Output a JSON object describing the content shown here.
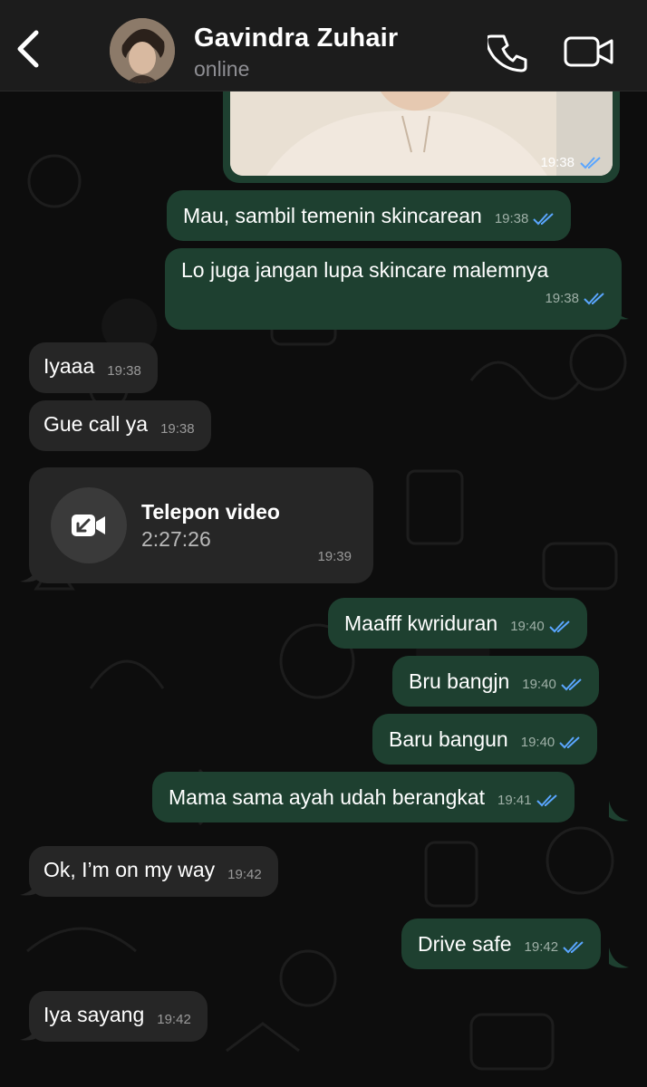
{
  "header": {
    "contact_name": "Gavindra Zuhair",
    "status": "online"
  },
  "messages": [
    {
      "type": "image",
      "direction": "out",
      "time": "19:38",
      "read": true
    },
    {
      "type": "text",
      "direction": "out",
      "text": "Mau, sambil temenin skincarean",
      "time": "19:38",
      "read": true
    },
    {
      "type": "text",
      "direction": "out",
      "text": "Lo juga jangan lupa skincare malemnya",
      "time": "19:38",
      "read": true
    },
    {
      "type": "text",
      "direction": "in",
      "text": "Iyaaa",
      "time": "19:38"
    },
    {
      "type": "text",
      "direction": "in",
      "text": "Gue call ya",
      "time": "19:38"
    },
    {
      "type": "call",
      "direction": "in",
      "title": "Telepon video",
      "duration": "2:27:26",
      "time": "19:39"
    },
    {
      "type": "text",
      "direction": "out",
      "text": "Maafff kwriduran",
      "time": "19:40",
      "read": true
    },
    {
      "type": "text",
      "direction": "out",
      "text": "Bru bangjn",
      "time": "19:40",
      "read": true
    },
    {
      "type": "text",
      "direction": "out",
      "text": "Baru bangun",
      "time": "19:40",
      "read": true
    },
    {
      "type": "text",
      "direction": "out",
      "text": "Mama sama ayah udah berangkat",
      "time": "19:41",
      "read": true
    },
    {
      "type": "text",
      "direction": "in",
      "text": "Ok, I’m on my way",
      "time": "19:42"
    },
    {
      "type": "text",
      "direction": "out",
      "text": "Drive safe",
      "time": "19:42",
      "read": true
    },
    {
      "type": "text",
      "direction": "in",
      "text": "Iya sayang",
      "time": "19:42"
    }
  ],
  "colors": {
    "outgoing_bubble": "#1e4030",
    "incoming_bubble": "#262626",
    "read_ticks": "#5aa6ff",
    "header_bg": "#1c1c1c"
  },
  "icons": [
    "back-chevron-icon",
    "phone-icon",
    "video-camera-icon",
    "video-call-missed-arrow-icon",
    "double-check-icon"
  ]
}
